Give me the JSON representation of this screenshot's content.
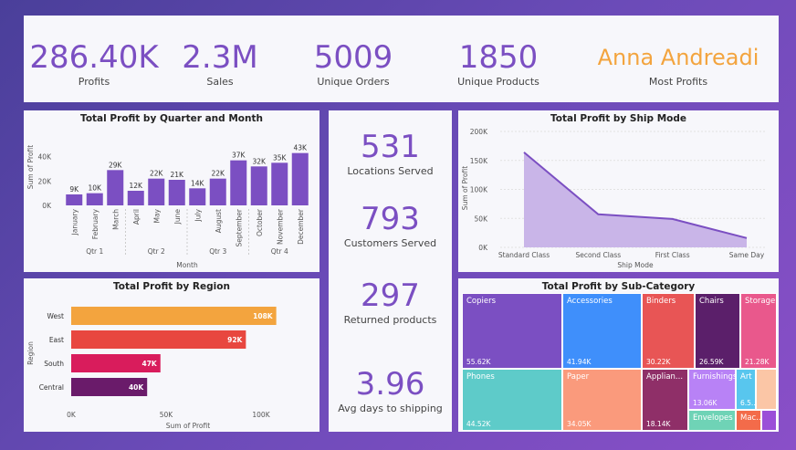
{
  "kpis": [
    {
      "value": "286.40K",
      "label": "Profits"
    },
    {
      "value": "2.3M",
      "label": "Sales"
    },
    {
      "value": "5009",
      "label": "Unique Orders"
    },
    {
      "value": "1850",
      "label": "Unique Products"
    },
    {
      "value": "Anna Andreadi",
      "label": "Most Profits"
    }
  ],
  "mid": [
    {
      "value": "531",
      "label": "Locations Served"
    },
    {
      "value": "793",
      "label": "Customers Served"
    },
    {
      "value": "297",
      "label": "Returned products"
    },
    {
      "value": "3.96",
      "label": "Avg days to shipping"
    }
  ],
  "colors": {
    "accent": "#7b4fc2",
    "orange": "#f3a43e"
  },
  "chart_data": [
    {
      "type": "bar",
      "title": "Total Profit by Quarter and Month",
      "ylabel": "Sum of Profit",
      "xlabel": "Month",
      "categories": [
        "January",
        "February",
        "March",
        "April",
        "May",
        "June",
        "July",
        "August",
        "September",
        "October",
        "November",
        "December"
      ],
      "quarters": [
        "Qtr 1",
        "Qtr 2",
        "Qtr 3",
        "Qtr 4"
      ],
      "values": [
        9,
        10,
        29,
        12,
        22,
        21,
        14,
        22,
        37,
        32,
        35,
        43
      ],
      "data_labels": [
        "9K",
        "10K",
        "29K",
        "12K",
        "22K",
        "21K",
        "14K",
        "22K",
        "37K",
        "32K",
        "35K",
        "43K"
      ],
      "yticks": [
        "0K",
        "20K",
        "40K"
      ],
      "ylim": [
        0,
        45
      ],
      "color": "#7b4fc2"
    },
    {
      "type": "area",
      "title": "Total Profit by Ship Mode",
      "ylabel": "Sum of Profit",
      "xlabel": "Ship Mode",
      "categories": [
        "Standard Class",
        "Second Class",
        "First Class",
        "Same Day"
      ],
      "values": [
        164,
        57,
        49,
        16
      ],
      "yticks": [
        "0K",
        "50K",
        "100K",
        "150K",
        "200K"
      ],
      "ylim": [
        0,
        200
      ],
      "color": "#7b4fc2"
    },
    {
      "type": "bar",
      "orientation": "horizontal",
      "title": "Total Profit by Region",
      "ylabel": "Region",
      "xlabel": "Sum of Profit",
      "categories": [
        "West",
        "East",
        "South",
        "Central"
      ],
      "values": [
        108,
        92,
        47,
        40
      ],
      "data_labels": [
        "108K",
        "92K",
        "47K",
        "40K"
      ],
      "colors": [
        "#f3a43e",
        "#e8473f",
        "#d91c5c",
        "#6a1b6a"
      ],
      "xticks": [
        "0K",
        "50K",
        "100K"
      ],
      "xlim": [
        0,
        125
      ]
    },
    {
      "type": "treemap",
      "title": "Total Profit by Sub-Category",
      "items": [
        {
          "name": "Copiers",
          "value": "55.62K",
          "color": "#7b4fc2"
        },
        {
          "name": "Phones",
          "value": "44.52K",
          "color": "#5ecbc9"
        },
        {
          "name": "Accessories",
          "value": "41.94K",
          "color": "#3f8ffb"
        },
        {
          "name": "Paper",
          "value": "34.05K",
          "color": "#fa9a7c"
        },
        {
          "name": "Binders",
          "value": "30.22K",
          "color": "#e85555"
        },
        {
          "name": "Appliances",
          "label": "Applian...",
          "value": "18.14K",
          "color": "#8f2f68"
        },
        {
          "name": "Chairs",
          "value": "26.59K",
          "color": "#5b1f6a"
        },
        {
          "name": "Storage",
          "value": "21.28K",
          "color": "#e9588c"
        },
        {
          "name": "Furnishings",
          "value": "13.06K",
          "color": "#b882f6"
        },
        {
          "name": "Envelopes",
          "value": "",
          "color": "#6fd3b6"
        },
        {
          "name": "Art",
          "value": "6.5...",
          "color": "#58c6ee"
        },
        {
          "name": "Machines",
          "label": "Mac...",
          "value": "",
          "color": "#f36b4a"
        }
      ]
    }
  ]
}
